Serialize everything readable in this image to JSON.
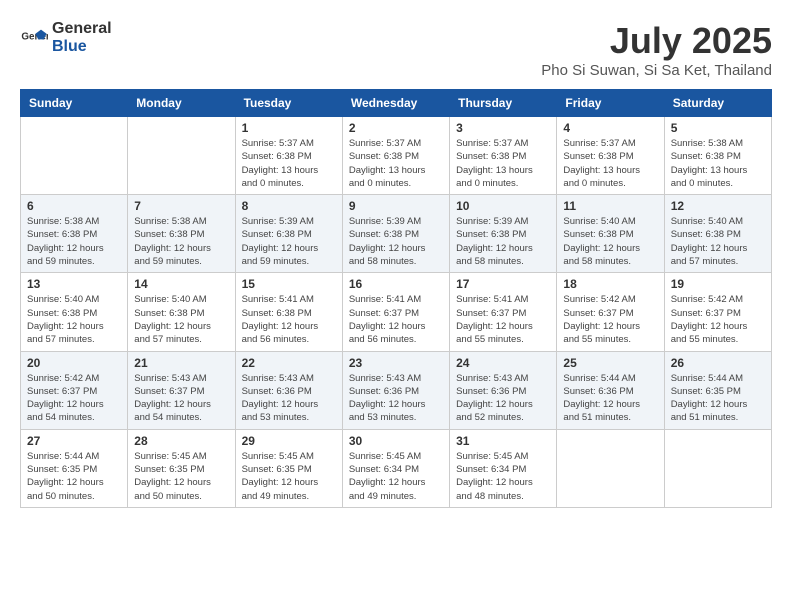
{
  "logo": {
    "general": "General",
    "blue": "Blue"
  },
  "header": {
    "month": "July 2025",
    "location": "Pho Si Suwan, Si Sa Ket, Thailand"
  },
  "weekdays": [
    "Sunday",
    "Monday",
    "Tuesday",
    "Wednesday",
    "Thursday",
    "Friday",
    "Saturday"
  ],
  "weeks": [
    [
      {
        "day": null
      },
      {
        "day": null
      },
      {
        "day": 1,
        "sunrise": "5:37 AM",
        "sunset": "6:38 PM",
        "daylight": "13 hours and 0 minutes."
      },
      {
        "day": 2,
        "sunrise": "5:37 AM",
        "sunset": "6:38 PM",
        "daylight": "13 hours and 0 minutes."
      },
      {
        "day": 3,
        "sunrise": "5:37 AM",
        "sunset": "6:38 PM",
        "daylight": "13 hours and 0 minutes."
      },
      {
        "day": 4,
        "sunrise": "5:37 AM",
        "sunset": "6:38 PM",
        "daylight": "13 hours and 0 minutes."
      },
      {
        "day": 5,
        "sunrise": "5:38 AM",
        "sunset": "6:38 PM",
        "daylight": "13 hours and 0 minutes."
      }
    ],
    [
      {
        "day": 6,
        "sunrise": "5:38 AM",
        "sunset": "6:38 PM",
        "daylight": "12 hours and 59 minutes."
      },
      {
        "day": 7,
        "sunrise": "5:38 AM",
        "sunset": "6:38 PM",
        "daylight": "12 hours and 59 minutes."
      },
      {
        "day": 8,
        "sunrise": "5:39 AM",
        "sunset": "6:38 PM",
        "daylight": "12 hours and 59 minutes."
      },
      {
        "day": 9,
        "sunrise": "5:39 AM",
        "sunset": "6:38 PM",
        "daylight": "12 hours and 58 minutes."
      },
      {
        "day": 10,
        "sunrise": "5:39 AM",
        "sunset": "6:38 PM",
        "daylight": "12 hours and 58 minutes."
      },
      {
        "day": 11,
        "sunrise": "5:40 AM",
        "sunset": "6:38 PM",
        "daylight": "12 hours and 58 minutes."
      },
      {
        "day": 12,
        "sunrise": "5:40 AM",
        "sunset": "6:38 PM",
        "daylight": "12 hours and 57 minutes."
      }
    ],
    [
      {
        "day": 13,
        "sunrise": "5:40 AM",
        "sunset": "6:38 PM",
        "daylight": "12 hours and 57 minutes."
      },
      {
        "day": 14,
        "sunrise": "5:40 AM",
        "sunset": "6:38 PM",
        "daylight": "12 hours and 57 minutes."
      },
      {
        "day": 15,
        "sunrise": "5:41 AM",
        "sunset": "6:38 PM",
        "daylight": "12 hours and 56 minutes."
      },
      {
        "day": 16,
        "sunrise": "5:41 AM",
        "sunset": "6:37 PM",
        "daylight": "12 hours and 56 minutes."
      },
      {
        "day": 17,
        "sunrise": "5:41 AM",
        "sunset": "6:37 PM",
        "daylight": "12 hours and 55 minutes."
      },
      {
        "day": 18,
        "sunrise": "5:42 AM",
        "sunset": "6:37 PM",
        "daylight": "12 hours and 55 minutes."
      },
      {
        "day": 19,
        "sunrise": "5:42 AM",
        "sunset": "6:37 PM",
        "daylight": "12 hours and 55 minutes."
      }
    ],
    [
      {
        "day": 20,
        "sunrise": "5:42 AM",
        "sunset": "6:37 PM",
        "daylight": "12 hours and 54 minutes."
      },
      {
        "day": 21,
        "sunrise": "5:43 AM",
        "sunset": "6:37 PM",
        "daylight": "12 hours and 54 minutes."
      },
      {
        "day": 22,
        "sunrise": "5:43 AM",
        "sunset": "6:36 PM",
        "daylight": "12 hours and 53 minutes."
      },
      {
        "day": 23,
        "sunrise": "5:43 AM",
        "sunset": "6:36 PM",
        "daylight": "12 hours and 53 minutes."
      },
      {
        "day": 24,
        "sunrise": "5:43 AM",
        "sunset": "6:36 PM",
        "daylight": "12 hours and 52 minutes."
      },
      {
        "day": 25,
        "sunrise": "5:44 AM",
        "sunset": "6:36 PM",
        "daylight": "12 hours and 51 minutes."
      },
      {
        "day": 26,
        "sunrise": "5:44 AM",
        "sunset": "6:35 PM",
        "daylight": "12 hours and 51 minutes."
      }
    ],
    [
      {
        "day": 27,
        "sunrise": "5:44 AM",
        "sunset": "6:35 PM",
        "daylight": "12 hours and 50 minutes."
      },
      {
        "day": 28,
        "sunrise": "5:45 AM",
        "sunset": "6:35 PM",
        "daylight": "12 hours and 50 minutes."
      },
      {
        "day": 29,
        "sunrise": "5:45 AM",
        "sunset": "6:35 PM",
        "daylight": "12 hours and 49 minutes."
      },
      {
        "day": 30,
        "sunrise": "5:45 AM",
        "sunset": "6:34 PM",
        "daylight": "12 hours and 49 minutes."
      },
      {
        "day": 31,
        "sunrise": "5:45 AM",
        "sunset": "6:34 PM",
        "daylight": "12 hours and 48 minutes."
      },
      {
        "day": null
      },
      {
        "day": null
      }
    ]
  ],
  "labels": {
    "sunrise": "Sunrise:",
    "sunset": "Sunset:",
    "daylight": "Daylight:"
  }
}
